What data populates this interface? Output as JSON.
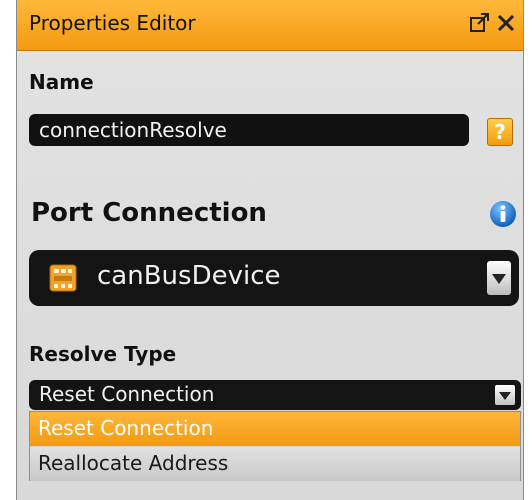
{
  "window": {
    "title": "Properties Editor",
    "actions": [
      {
        "name": "popout",
        "icon": "popout-icon"
      },
      {
        "name": "close",
        "icon": "close-icon"
      }
    ]
  },
  "name_section": {
    "label": "Name",
    "value": "connectionResolve",
    "help_label": "?"
  },
  "port_connection": {
    "label": "Port Connection",
    "selected_value": "canBusDevice",
    "icon": "device-icon",
    "info_icon": "info-icon"
  },
  "resolve_type": {
    "label": "Resolve Type",
    "selected_value": "Reset Connection",
    "options": [
      {
        "label": "Reset Connection",
        "selected": true
      },
      {
        "label": "Reallocate Address",
        "selected": false
      }
    ]
  },
  "colors": {
    "accent": "#f59a12",
    "field_bg": "#141414",
    "panel_bg": "#d9d9d9"
  }
}
